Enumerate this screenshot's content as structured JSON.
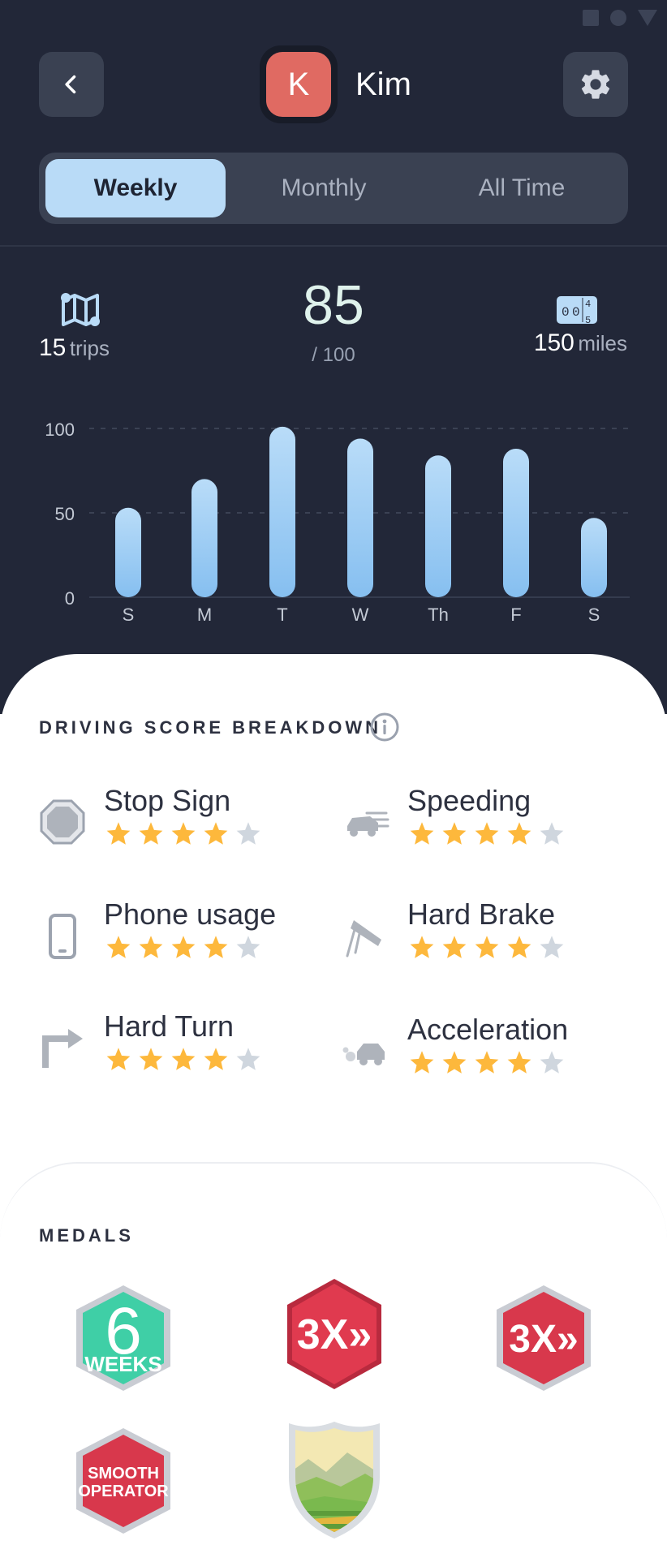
{
  "header": {
    "user_initial": "K",
    "user_name": "Kim"
  },
  "tabs": [
    {
      "label": "Weekly",
      "active": true
    },
    {
      "label": "Monthly",
      "active": false
    },
    {
      "label": "All Time",
      "active": false
    }
  ],
  "stats": {
    "trips_value": "15",
    "trips_unit": "trips",
    "score": "85",
    "score_max": "/ 100",
    "miles_value": "150",
    "miles_unit": "miles",
    "odometer_icon": "odometer-icon",
    "map_icon": "route-map-icon"
  },
  "chart_data": {
    "type": "bar",
    "categories": [
      "S",
      "M",
      "T",
      "W",
      "Th",
      "F",
      "S"
    ],
    "values": [
      53,
      70,
      101,
      94,
      84,
      88,
      47
    ],
    "ylim": [
      0,
      100
    ],
    "yticks": [
      "100",
      "50",
      "0"
    ],
    "bar_color": "#86bff0",
    "grid": "dashed"
  },
  "breakdown": {
    "title": "DRIVING SCORE BREAKDOWN",
    "info_icon": "info-icon",
    "items": [
      {
        "label": "Stop Sign",
        "icon": "stop-sign-icon",
        "rating": 4,
        "max": 5
      },
      {
        "label": "Speeding",
        "icon": "speeding-car-icon",
        "rating": 4,
        "max": 5
      },
      {
        "label": "Phone usage",
        "icon": "phone-icon",
        "rating": 4,
        "max": 5
      },
      {
        "label": "Hard Brake",
        "icon": "brake-pedal-icon",
        "rating": 4,
        "max": 5
      },
      {
        "label": "Hard Turn",
        "icon": "turn-arrow-icon",
        "rating": 4,
        "max": 5
      },
      {
        "label": "Acceleration",
        "icon": "acceleration-car-icon",
        "rating": 4,
        "max": 5
      }
    ]
  },
  "medals": {
    "title": "MEDALS",
    "items": [
      {
        "name": "six-weeks-medal",
        "line1": "6",
        "line2": "WEEKS",
        "color": "#3fcfa6"
      },
      {
        "name": "three-x-medal",
        "line1": "3X»",
        "color": "#e03a4f"
      },
      {
        "name": "three-x-medal-outlined",
        "line1": "3X»",
        "color": "#d8384c"
      },
      {
        "name": "smooth-operator-medal",
        "line1": "SMOOTH",
        "line2": "OPERATOR",
        "color": "#d8384c"
      },
      {
        "name": "landscape-shield-medal",
        "color": "#7ab94e"
      }
    ]
  },
  "colors": {
    "background_dark": "#222738",
    "panel": "#3a4152",
    "accent_tab": "#b9dbf7",
    "avatar": "#e06a62",
    "star_filled": "#fdb83c",
    "star_empty": "#cfd6de"
  }
}
